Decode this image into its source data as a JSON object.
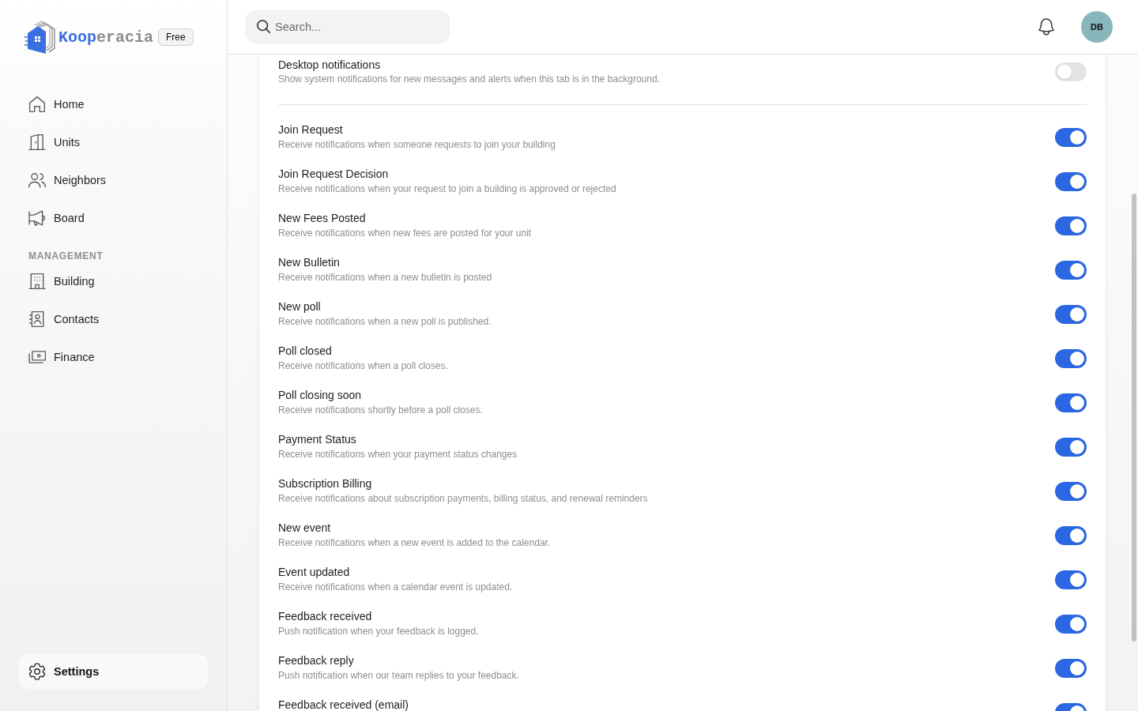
{
  "sidebar": {
    "logo": {
      "wordmark": [
        {
          "text": "Koop",
          "color": "#3a6fe2"
        },
        {
          "text": "eracia",
          "color": "#8c8c8c"
        }
      ],
      "plan_badge": "Free"
    },
    "nav": [
      {
        "label": "Home",
        "selected": false
      },
      {
        "label": "Units",
        "selected": false
      },
      {
        "label": "Neighbors",
        "selected": false
      },
      {
        "label": "Board",
        "selected": false
      }
    ],
    "sections": [
      {
        "heading": "MANAGEMENT",
        "items": [
          {
            "label": "Building",
            "selected": false
          },
          {
            "label": "Contacts",
            "selected": false
          },
          {
            "label": "Finance",
            "selected": false
          }
        ]
      }
    ],
    "footer": [
      {
        "label": "Settings",
        "selected": true
      }
    ]
  },
  "header": {
    "search": {
      "placeholder": "Search..."
    },
    "avatar": {
      "initials": "DB"
    }
  },
  "settings": {
    "desktop_notifications": {
      "title": "Desktop notifications",
      "description": "Show system notifications for new messages and alerts when this tab is in the background.",
      "on": false
    },
    "notifications": [
      {
        "title": "Join Request",
        "description": "Receive notifications when someone requests to join your building",
        "on": true
      },
      {
        "title": "Join Request Decision",
        "description": "Receive notifications when your request to join a building is approved or rejected",
        "on": true
      },
      {
        "title": "New Fees Posted",
        "description": "Receive notifications when new fees are posted for your unit",
        "on": true
      },
      {
        "title": "New Bulletin",
        "description": "Receive notifications when a new bulletin is posted",
        "on": true
      },
      {
        "title": "New poll",
        "description": "Receive notifications when a new poll is published.",
        "on": true
      },
      {
        "title": "Poll closed",
        "description": "Receive notifications when a poll closes.",
        "on": true
      },
      {
        "title": "Poll closing soon",
        "description": "Receive notifications shortly before a poll closes.",
        "on": true
      },
      {
        "title": "Payment Status",
        "description": "Receive notifications when your payment status changes",
        "on": true
      },
      {
        "title": "Subscription Billing",
        "description": "Receive notifications about subscription payments, billing status, and renewal reminders",
        "on": true
      },
      {
        "title": "New event",
        "description": "Receive notifications when a new event is added to the calendar.",
        "on": true
      },
      {
        "title": "Event updated",
        "description": "Receive notifications when a calendar event is updated.",
        "on": true
      },
      {
        "title": "Feedback received",
        "description": "Push notification when your feedback is logged.",
        "on": true
      },
      {
        "title": "Feedback reply",
        "description": "Push notification when our team replies to your feedback.",
        "on": true
      },
      {
        "title": "Feedback received (email)",
        "on": true
      }
    ]
  }
}
